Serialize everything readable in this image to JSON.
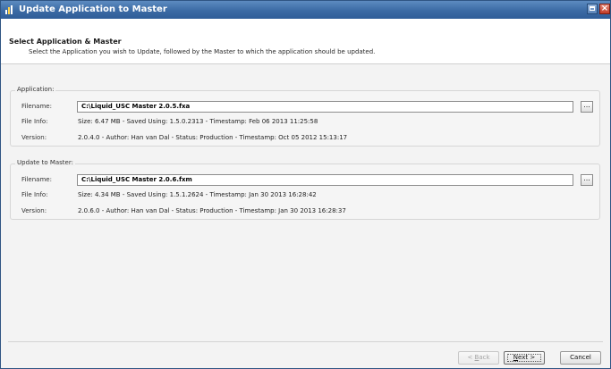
{
  "window": {
    "title": "Update Application to Master",
    "accent_color": "#3b6aa4"
  },
  "header": {
    "title": "Select Application & Master",
    "subtitle": "Select the Application you wish to Update, followed by the Master to which the application should be updated."
  },
  "application": {
    "legend": "Application:",
    "filename_label": "Filename:",
    "filename_value": "C:\\Liquid_USC Master 2.0.5.fxa",
    "fileinfo_label": "File Info:",
    "fileinfo_value": "Size: 6.47 MB - Saved Using: 1.5.0.2313 - Timestamp: Feb 06 2013 11:25:58",
    "version_label": "Version:",
    "version_value": "2.0.4.0 - Author: Han van Dal - Status: Production - Timestamp: Oct 05 2012 15:13:17",
    "browse_label": "..."
  },
  "master": {
    "legend": "Update to Master:",
    "filename_label": "Filename:",
    "filename_value": "C:\\Liquid_USC Master 2.0.6.fxm",
    "fileinfo_label": "File Info:",
    "fileinfo_value": "Size: 4.34 MB - Saved Using: 1.5.1.2624 - Timestamp: Jan 30 2013 16:28:42",
    "version_label": "Version:",
    "version_value": "2.0.6.0 - Author: Han van Dal - Status: Production - Timestamp: Jan 30 2013 16:28:37",
    "browse_label": "..."
  },
  "buttons": {
    "back_mnemonic": "B",
    "back_rest": "ack",
    "back_prefix": "< ",
    "next_mnemonic": "N",
    "next_rest": "ext >",
    "cancel": "Cancel"
  }
}
